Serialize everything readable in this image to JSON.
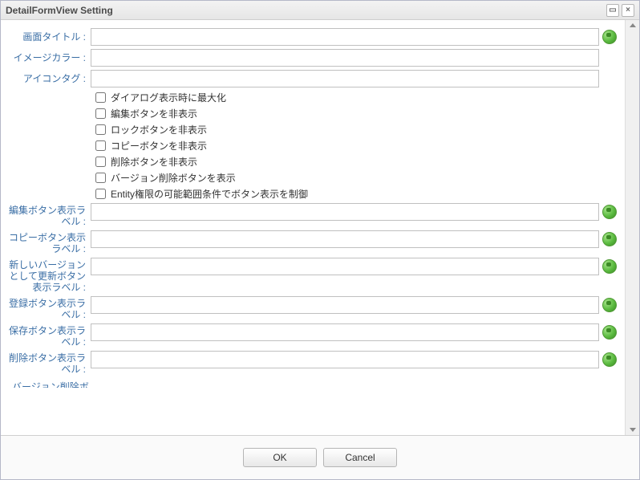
{
  "window": {
    "title": "DetailFormView Setting"
  },
  "fields": {
    "screenTitle": {
      "label": "画面タイトル :",
      "value": "",
      "hasGlobe": true
    },
    "imageColor": {
      "label": "イメージカラー :",
      "value": "",
      "hasGlobe": false
    },
    "iconTag": {
      "label": "アイコンタグ :",
      "value": "",
      "hasGlobe": false
    }
  },
  "checkboxes": [
    {
      "label": "ダイアログ表示時に最大化",
      "checked": false
    },
    {
      "label": "編集ボタンを非表示",
      "checked": false
    },
    {
      "label": "ロックボタンを非表示",
      "checked": false
    },
    {
      "label": "コピーボタンを非表示",
      "checked": false
    },
    {
      "label": "削除ボタンを非表示",
      "checked": false
    },
    {
      "label": "バージョン削除ボタンを表示",
      "checked": false
    },
    {
      "label": "Entity権限の可能範囲条件でボタン表示を制御",
      "checked": false
    }
  ],
  "labelFields": {
    "editButton": {
      "label": "編集ボタン表示ラベル :",
      "value": ""
    },
    "copyButton": {
      "label": "コピーボタン表示ラベル :",
      "value": ""
    },
    "newVersion": {
      "label": "新しいバージョンとして更新ボタン表示ラベル :",
      "value": ""
    },
    "registerButton": {
      "label": "登録ボタン表示ラベル :",
      "value": ""
    },
    "saveButton": {
      "label": "保存ボタン表示ラベル :",
      "value": ""
    },
    "deleteButton": {
      "label": "削除ボタン表示ラベル :",
      "value": ""
    }
  },
  "overflow": {
    "label": "バージョン削除ボ"
  },
  "footer": {
    "ok": "OK",
    "cancel": "Cancel"
  }
}
